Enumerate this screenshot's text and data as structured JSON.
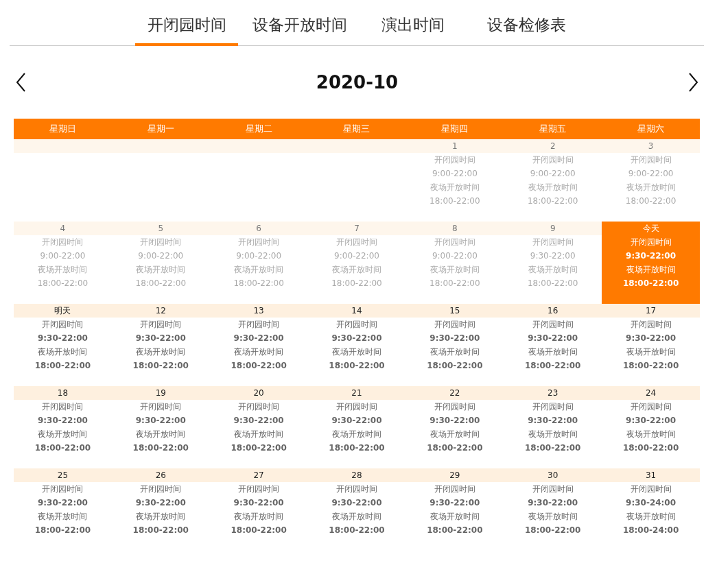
{
  "tabs": [
    {
      "label": "开闭园时间",
      "selected": true
    },
    {
      "label": "设备开放时间",
      "selected": false
    },
    {
      "label": "演出时间",
      "selected": false
    },
    {
      "label": "设备检修表",
      "selected": false
    }
  ],
  "calendar": {
    "month": "2020-10",
    "weekdays": [
      "星期日",
      "星期一",
      "星期二",
      "星期三",
      "星期四",
      "星期五",
      "星期六"
    ],
    "weeks": [
      [
        {
          "kind": "empty"
        },
        {
          "kind": "empty"
        },
        {
          "kind": "empty"
        },
        {
          "kind": "empty"
        },
        {
          "kind": "past",
          "day": "1",
          "park_label": "开闭园时间",
          "park_hours": "9:00-22:00",
          "night_label": "夜场开放时间",
          "night_hours": "18:00-22:00"
        },
        {
          "kind": "past",
          "day": "2",
          "park_label": "开闭园时间",
          "park_hours": "9:00-22:00",
          "night_label": "夜场开放时间",
          "night_hours": "18:00-22:00"
        },
        {
          "kind": "past",
          "day": "3",
          "park_label": "开闭园时间",
          "park_hours": "9:00-22:00",
          "night_label": "夜场开放时间",
          "night_hours": "18:00-22:00"
        }
      ],
      [
        {
          "kind": "past",
          "day": "4",
          "park_label": "开闭园时间",
          "park_hours": "9:00-22:00",
          "night_label": "夜场开放时间",
          "night_hours": "18:00-22:00"
        },
        {
          "kind": "past",
          "day": "5",
          "park_label": "开闭园时间",
          "park_hours": "9:00-22:00",
          "night_label": "夜场开放时间",
          "night_hours": "18:00-22:00"
        },
        {
          "kind": "past",
          "day": "6",
          "park_label": "开闭园时间",
          "park_hours": "9:00-22:00",
          "night_label": "夜场开放时间",
          "night_hours": "18:00-22:00"
        },
        {
          "kind": "past",
          "day": "7",
          "park_label": "开闭园时间",
          "park_hours": "9:00-22:00",
          "night_label": "夜场开放时间",
          "night_hours": "18:00-22:00"
        },
        {
          "kind": "past",
          "day": "8",
          "park_label": "开闭园时间",
          "park_hours": "9:00-22:00",
          "night_label": "夜场开放时间",
          "night_hours": "18:00-22:00"
        },
        {
          "kind": "past",
          "day": "9",
          "park_label": "开闭园时间",
          "park_hours": "9:30-22:00",
          "night_label": "夜场开放时间",
          "night_hours": "18:00-22:00"
        },
        {
          "kind": "today",
          "day": "今天",
          "park_label": "开闭园时间",
          "park_hours": "9:30-22:00",
          "night_label": "夜场开放时间",
          "night_hours": "18:00-22:00"
        }
      ],
      [
        {
          "kind": "upcoming",
          "day": "明天",
          "park_label": "开闭园时间",
          "park_hours": "9:30-22:00",
          "night_label": "夜场开放时间",
          "night_hours": "18:00-22:00"
        },
        {
          "kind": "upcoming",
          "day": "12",
          "park_label": "开闭园时间",
          "park_hours": "9:30-22:00",
          "night_label": "夜场开放时间",
          "night_hours": "18:00-22:00"
        },
        {
          "kind": "upcoming",
          "day": "13",
          "park_label": "开闭园时间",
          "park_hours": "9:30-22:00",
          "night_label": "夜场开放时间",
          "night_hours": "18:00-22:00"
        },
        {
          "kind": "upcoming",
          "day": "14",
          "park_label": "开闭园时间",
          "park_hours": "9:30-22:00",
          "night_label": "夜场开放时间",
          "night_hours": "18:00-22:00"
        },
        {
          "kind": "upcoming",
          "day": "15",
          "park_label": "开闭园时间",
          "park_hours": "9:30-22:00",
          "night_label": "夜场开放时间",
          "night_hours": "18:00-22:00"
        },
        {
          "kind": "upcoming",
          "day": "16",
          "park_label": "开闭园时间",
          "park_hours": "9:30-22:00",
          "night_label": "夜场开放时间",
          "night_hours": "18:00-22:00"
        },
        {
          "kind": "upcoming",
          "day": "17",
          "park_label": "开闭园时间",
          "park_hours": "9:30-22:00",
          "night_label": "夜场开放时间",
          "night_hours": "18:00-22:00"
        }
      ],
      [
        {
          "kind": "upcoming",
          "day": "18",
          "park_label": "开闭园时间",
          "park_hours": "9:30-22:00",
          "night_label": "夜场开放时间",
          "night_hours": "18:00-22:00"
        },
        {
          "kind": "upcoming",
          "day": "19",
          "park_label": "开闭园时间",
          "park_hours": "9:30-22:00",
          "night_label": "夜场开放时间",
          "night_hours": "18:00-22:00"
        },
        {
          "kind": "upcoming",
          "day": "20",
          "park_label": "开闭园时间",
          "park_hours": "9:30-22:00",
          "night_label": "夜场开放时间",
          "night_hours": "18:00-22:00"
        },
        {
          "kind": "upcoming",
          "day": "21",
          "park_label": "开闭园时间",
          "park_hours": "9:30-22:00",
          "night_label": "夜场开放时间",
          "night_hours": "18:00-22:00"
        },
        {
          "kind": "upcoming",
          "day": "22",
          "park_label": "开闭园时间",
          "park_hours": "9:30-22:00",
          "night_label": "夜场开放时间",
          "night_hours": "18:00-22:00"
        },
        {
          "kind": "upcoming",
          "day": "23",
          "park_label": "开闭园时间",
          "park_hours": "9:30-22:00",
          "night_label": "夜场开放时间",
          "night_hours": "18:00-22:00"
        },
        {
          "kind": "upcoming",
          "day": "24",
          "park_label": "开闭园时间",
          "park_hours": "9:30-22:00",
          "night_label": "夜场开放时间",
          "night_hours": "18:00-22:00"
        }
      ],
      [
        {
          "kind": "upcoming",
          "day": "25",
          "park_label": "开闭园时间",
          "park_hours": "9:30-22:00",
          "night_label": "夜场开放时间",
          "night_hours": "18:00-22:00"
        },
        {
          "kind": "upcoming",
          "day": "26",
          "park_label": "开闭园时间",
          "park_hours": "9:30-22:00",
          "night_label": "夜场开放时间",
          "night_hours": "18:00-22:00"
        },
        {
          "kind": "upcoming",
          "day": "27",
          "park_label": "开闭园时间",
          "park_hours": "9:30-22:00",
          "night_label": "夜场开放时间",
          "night_hours": "18:00-22:00"
        },
        {
          "kind": "upcoming",
          "day": "28",
          "park_label": "开闭园时间",
          "park_hours": "9:30-22:00",
          "night_label": "夜场开放时间",
          "night_hours": "18:00-22:00"
        },
        {
          "kind": "upcoming",
          "day": "29",
          "park_label": "开闭园时间",
          "park_hours": "9:30-22:00",
          "night_label": "夜场开放时间",
          "night_hours": "18:00-22:00"
        },
        {
          "kind": "upcoming",
          "day": "30",
          "park_label": "开闭园时间",
          "park_hours": "9:30-22:00",
          "night_label": "夜场开放时间",
          "night_hours": "18:00-22:00"
        },
        {
          "kind": "upcoming",
          "day": "31",
          "park_label": "开闭园时间",
          "park_hours": "9:30-24:00",
          "night_label": "夜场开放时间",
          "night_hours": "18:00-24:00"
        }
      ]
    ]
  }
}
